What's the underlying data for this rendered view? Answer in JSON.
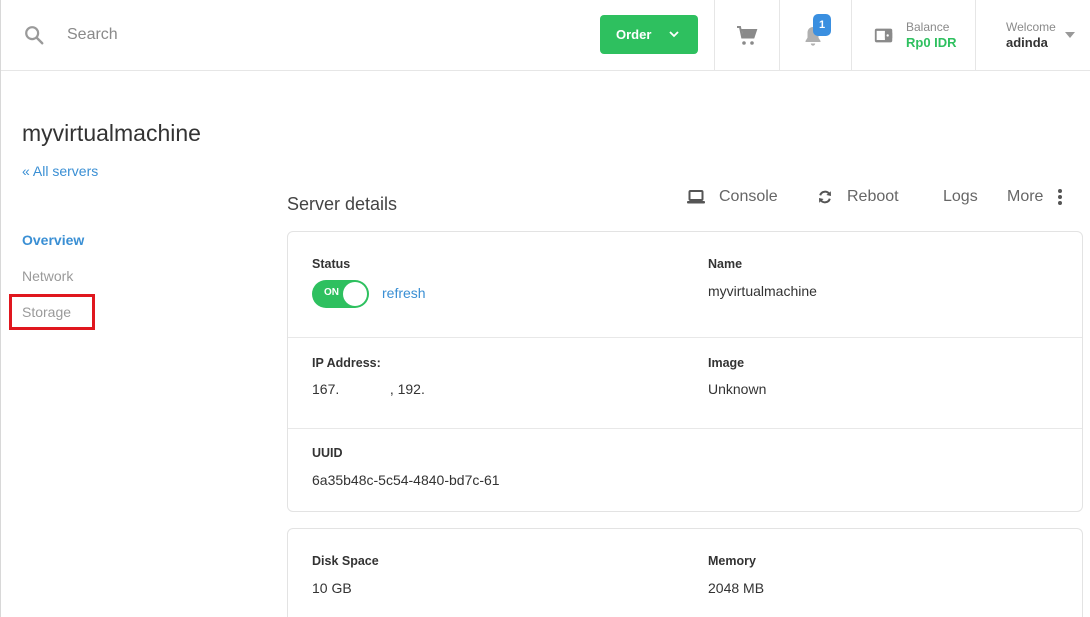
{
  "header": {
    "search_placeholder": "Search",
    "order_label": "Order",
    "notification_count": "1",
    "balance_label": "Balance",
    "balance_value": "Rp0 IDR",
    "welcome_label": "Welcome",
    "username": "adinda"
  },
  "page": {
    "title": "myvirtualmachine",
    "back_link": "« All servers"
  },
  "sidebar": {
    "items": [
      {
        "label": "Overview"
      },
      {
        "label": "Network"
      },
      {
        "label": "Storage"
      }
    ]
  },
  "main": {
    "section_title": "Server details",
    "actions": {
      "console": "Console",
      "reboot": "Reboot",
      "logs": "Logs",
      "more": "More"
    },
    "details": {
      "status_label": "Status",
      "toggle_label": "ON",
      "refresh_label": "refresh",
      "name_label": "Name",
      "name_value": "myvirtualmachine",
      "ip_label": "IP Address:",
      "ip_value": "167.             , 192.",
      "image_label": "Image",
      "image_value": "Unknown",
      "uuid_label": "UUID",
      "uuid_value": "6a35b48c-5c54-4840-bd7c-61"
    },
    "resources": {
      "disk_label": "Disk Space",
      "disk_value": "10 GB",
      "memory_label": "Memory",
      "memory_value": "2048 MB"
    }
  },
  "colors": {
    "accent_green": "#2ec05f",
    "link_blue": "#3a8fd4",
    "highlight_red": "#e0171e"
  }
}
